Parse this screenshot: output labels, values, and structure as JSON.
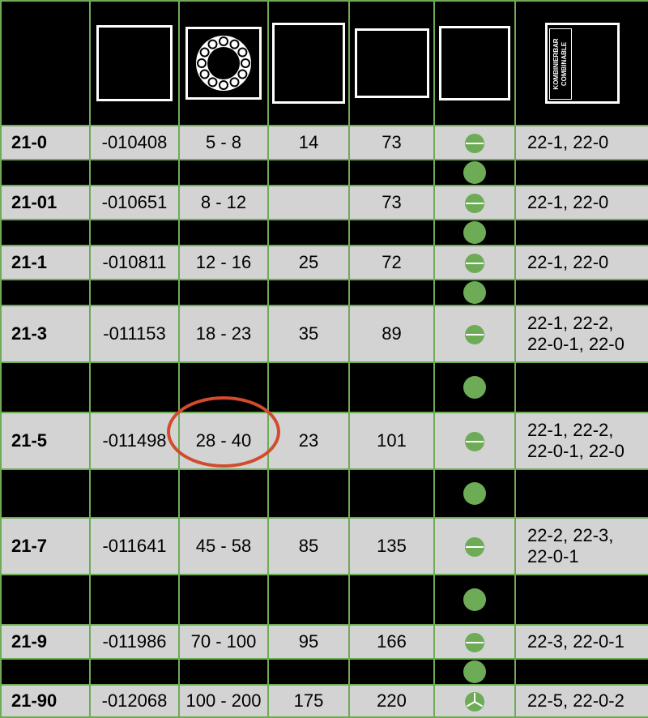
{
  "header": {
    "combinable_label_1": "KOMBINIERBAR",
    "combinable_label_2": "COMBINABLE",
    "bearing_icon": "bearing-ring-icon"
  },
  "colors": {
    "border": "#6dab57",
    "icon": "#6dab57",
    "highlight": "#d24b2f",
    "row_light": "#d3d3d3"
  },
  "rows": [
    {
      "type": "21-0",
      "code": "-010408",
      "range": "5 - 8",
      "dim1": "14",
      "dim2": "73",
      "icon": "flat-slot-icon",
      "combinable": [
        "22-1, 22-0"
      ]
    },
    {
      "type": "21-01",
      "code": "-010651",
      "range": "8 - 12",
      "dim1": "",
      "dim2": "73",
      "icon": "flat-slot-icon",
      "combinable": [
        "22-1, 22-0"
      ]
    },
    {
      "type": "21-1",
      "code": "-010811",
      "range": "12 - 16",
      "dim1": "25",
      "dim2": "72",
      "icon": "flat-slot-icon",
      "combinable": [
        "22-1, 22-0"
      ]
    },
    {
      "type": "21-3",
      "code": "-011153",
      "range": "18 - 23",
      "dim1": "35",
      "dim2": "89",
      "icon": "flat-slot-icon",
      "combinable": [
        "22-1, 22-2,",
        "22-0-1, 22-0"
      ]
    },
    {
      "type": "21-5",
      "code": "-011498",
      "range": "28 - 40",
      "dim1": "23",
      "dim2": "101",
      "icon": "flat-slot-icon",
      "combinable": [
        "22-1, 22-2,",
        "22-0-1, 22-0"
      ]
    },
    {
      "type": "21-7",
      "code": "-011641",
      "range": "45 - 58",
      "dim1": "85",
      "dim2": "135",
      "icon": "flat-slot-icon",
      "combinable": [
        "22-2, 22-3,",
        "22-0-1"
      ]
    },
    {
      "type": "21-9",
      "code": "-011986",
      "range": "70 - 100",
      "dim1": "95",
      "dim2": "166",
      "icon": "flat-slot-icon",
      "combinable": [
        "22-3, 22-0-1"
      ]
    },
    {
      "type": "21-90",
      "code": "-012068",
      "range": "100 - 200",
      "dim1": "175",
      "dim2": "220",
      "icon": "three-jaw-icon",
      "combinable": [
        "22-5, 22-0-2"
      ]
    }
  ]
}
